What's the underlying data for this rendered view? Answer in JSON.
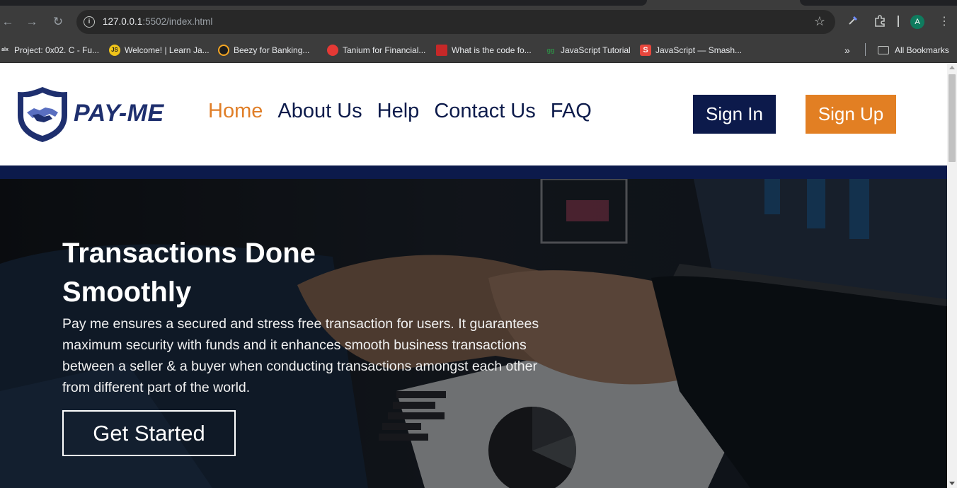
{
  "browser": {
    "url_host": "127.0.0.1",
    "url_rest": ":5502/index.html",
    "profile_initial": "A",
    "bookmarks": [
      {
        "label": "Project: 0x02. C - Fu...",
        "icon": "alx-icon"
      },
      {
        "label": "Welcome! | Learn Ja...",
        "icon": "js-icon"
      },
      {
        "label": "Beezy for Banking...",
        "icon": "beezy-icon"
      },
      {
        "label": "Tanium for Financial...",
        "icon": "tanium-icon"
      },
      {
        "label": "What is the code fo...",
        "icon": "code-site-icon"
      },
      {
        "label": "JavaScript Tutorial",
        "icon": "gfg-icon"
      },
      {
        "label": "JavaScript — Smash...",
        "icon": "smashing-icon"
      }
    ],
    "all_bookmarks_label": "All Bookmarks"
  },
  "site": {
    "logo_text": "PAY-ME",
    "nav": [
      "Home",
      "About Us",
      "Help",
      "Contact Us",
      "FAQ"
    ],
    "active_nav": "Home",
    "sign_in_label": "Sign In",
    "sign_up_label": "Sign Up",
    "hero": {
      "title": "Transactions Done Smoothly",
      "text": "Pay me ensures a secured and stress free transaction for users. It guarantees maximum security with funds and it enhances smooth business transactions between a seller & a buyer when conducting transactions amongst each other from different part of the world.",
      "cta_label": "Get Started"
    }
  },
  "colors": {
    "brand_navy": "#0c1a4b",
    "brand_orange": "#e27f23",
    "browser_chrome": "#3c3c3c"
  }
}
